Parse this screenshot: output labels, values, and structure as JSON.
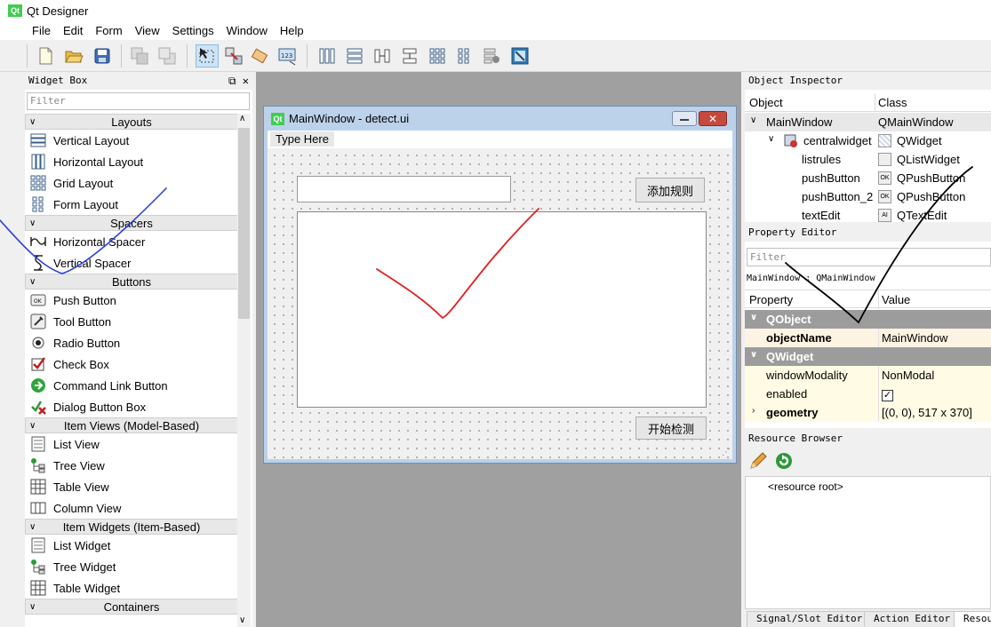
{
  "app": {
    "title": "Qt Designer",
    "logo": "Qt"
  },
  "menubar": [
    "File",
    "Edit",
    "Form",
    "View",
    "Settings",
    "Window",
    "Help"
  ],
  "widget_box": {
    "title": "Widget Box",
    "filter_placeholder": "Filter",
    "categories": [
      {
        "name": "Layouts",
        "items": [
          "Vertical Layout",
          "Horizontal Layout",
          "Grid Layout",
          "Form Layout"
        ]
      },
      {
        "name": "Spacers",
        "items": [
          "Horizontal Spacer",
          "Vertical Spacer"
        ]
      },
      {
        "name": "Buttons",
        "items": [
          "Push Button",
          "Tool Button",
          "Radio Button",
          "Check Box",
          "Command Link Button",
          "Dialog Button Box"
        ]
      },
      {
        "name": "Item Views (Model-Based)",
        "items": [
          "List View",
          "Tree View",
          "Table View",
          "Column View"
        ]
      },
      {
        "name": "Item Widgets (Item-Based)",
        "items": [
          "List Widget",
          "Tree Widget",
          "Table Widget"
        ]
      },
      {
        "name": "Containers",
        "items": []
      }
    ]
  },
  "form": {
    "logo": "Qt",
    "title": "MainWindow - detect.ui",
    "menu_placeholder": "Type Here",
    "add_rule_button": "添加规则",
    "start_detect_button": "开始检测"
  },
  "object_inspector": {
    "title": "Object Inspector",
    "col_object": "Object",
    "col_class": "Class",
    "rows": [
      {
        "name": "MainWindow",
        "class": "QMainWindow"
      },
      {
        "name": "centralwidget",
        "class": "QWidget"
      },
      {
        "name": "listrules",
        "class": "QListWidget"
      },
      {
        "name": "pushButton",
        "class": "QPushButton"
      },
      {
        "name": "pushButton_2",
        "class": "QPushButton"
      },
      {
        "name": "textEdit",
        "class": "QTextEdit"
      }
    ]
  },
  "property_editor": {
    "title": "Property Editor",
    "filter_placeholder": "Filter",
    "object_line": "MainWindow : QMainWindow",
    "col_property": "Property",
    "col_value": "Value",
    "groups": [
      {
        "name": "QObject",
        "props": [
          {
            "name": "objectName",
            "value": "MainWindow"
          }
        ]
      },
      {
        "name": "QWidget",
        "props": [
          {
            "name": "windowModality",
            "value": "NonModal"
          },
          {
            "name": "enabled",
            "value": ""
          },
          {
            "name": "geometry",
            "value": "[(0, 0), 517 x 370]"
          }
        ]
      }
    ]
  },
  "resource_browser": {
    "title": "Resource Browser",
    "root": "<resource root>"
  },
  "bottom_tabs": [
    "Signal/Slot Editor",
    "Action Editor",
    "Resour"
  ],
  "colors": {
    "accent_red": "#e02020",
    "qt_green": "#41cd52"
  }
}
